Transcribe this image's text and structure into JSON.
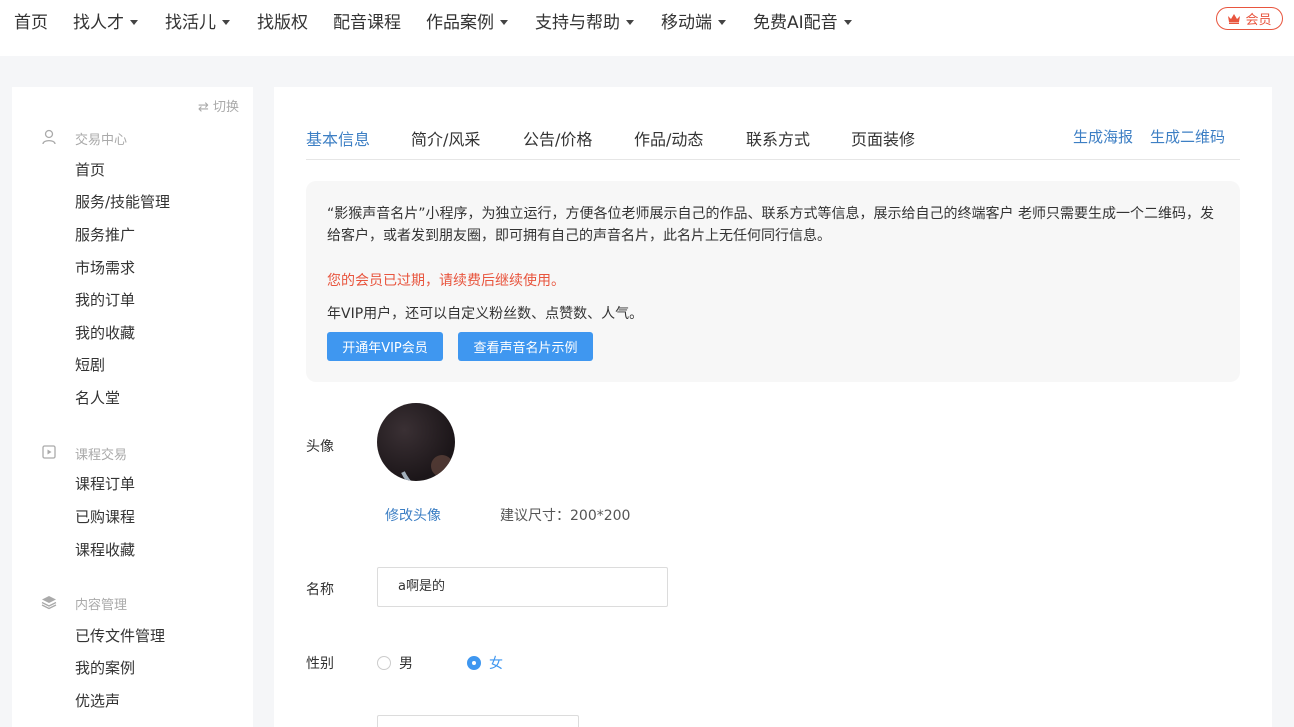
{
  "nav": {
    "items": [
      {
        "label": "首页",
        "caret": false
      },
      {
        "label": "找人才",
        "caret": true
      },
      {
        "label": "找活儿",
        "caret": true
      },
      {
        "label": "找版权",
        "caret": false
      },
      {
        "label": "配音课程",
        "caret": false
      },
      {
        "label": "作品案例",
        "caret": true
      },
      {
        "label": "支持与帮助",
        "caret": true
      },
      {
        "label": "移动端",
        "caret": true
      },
      {
        "label": "免费AI配音",
        "caret": true
      }
    ],
    "member_label": "会员"
  },
  "sidebar": {
    "switch_label": "⇄ 切换",
    "sections": [
      {
        "title": "交易中心",
        "icon": "user-icon",
        "items": [
          "首页",
          "服务/技能管理",
          "服务推广",
          "市场需求",
          "我的订单",
          "我的收藏",
          "短剧",
          "名人堂"
        ]
      },
      {
        "title": "课程交易",
        "icon": "video-icon",
        "items": [
          "课程订单",
          "已购课程",
          "课程收藏"
        ]
      },
      {
        "title": "内容管理",
        "icon": "layers-icon",
        "items": [
          "已传文件管理",
          "我的案例",
          "优选声"
        ]
      }
    ]
  },
  "tabs": {
    "items": [
      "基本信息",
      "简介/风采",
      "公告/价格",
      "作品/动态",
      "联系方式",
      "页面装修"
    ],
    "active": 0,
    "links": [
      "生成海报",
      "生成二维码"
    ]
  },
  "notice": {
    "description": "“影猴声音名片”小程序，为独立运行，方便各位老师展示自己的作品、联系方式等信息，展示给自己的终端客户 老师只需要生成一个二维码，发给客户，或者发到朋友圈，即可拥有自己的声音名片，此名片上无任何同行信息。",
    "warning": "您的会员已过期，请续费后继续使用。",
    "vip_hint": "年VIP用户，还可以自定义粉丝数、点赞数、人气。",
    "buttons": [
      "开通年VIP会员",
      "查看声音名片示例"
    ]
  },
  "form": {
    "avatar_label": "头像",
    "modify_avatar": "修改头像",
    "size_hint": "建议尺寸：200*200",
    "name_label": "名称",
    "name_value": "a啊是的",
    "gender_label": "性别",
    "gender_options": [
      "男",
      "女"
    ],
    "gender_selected": 1
  },
  "colors": {
    "accent": "#3f97f0",
    "link": "#3d7fc4",
    "warning": "#e8553e"
  }
}
